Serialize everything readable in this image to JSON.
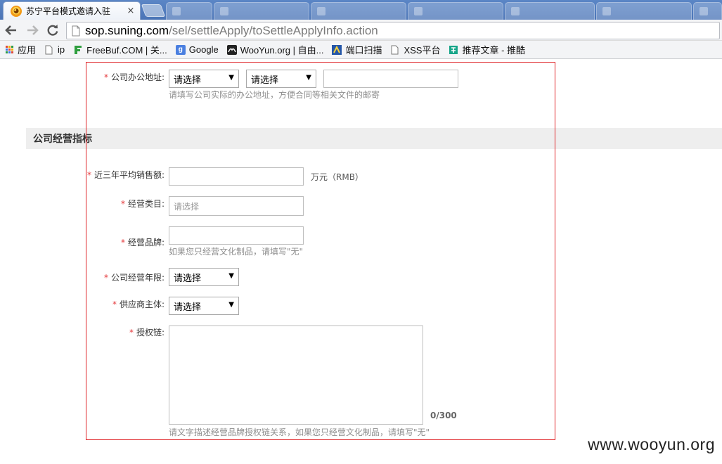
{
  "browser": {
    "active_tab": {
      "title": "苏宁平台模式邀请入驻",
      "close": "×"
    },
    "address": {
      "host": "sop.suning.com",
      "path": "/sel/settleApply/toSettleApplyInfo.action"
    },
    "bookmarks": [
      {
        "label": "应用",
        "icon": "apps-grid-icon"
      },
      {
        "label": "ip",
        "icon": "page-icon"
      },
      {
        "label": "FreeBuf.COM | 关...",
        "icon": "freebuf-icon"
      },
      {
        "label": "Google",
        "icon": "google-icon"
      },
      {
        "label": "WooYun.org | 自由...",
        "icon": "wooyun-icon"
      },
      {
        "label": "端口扫描",
        "icon": "portscan-icon"
      },
      {
        "label": "XSS平台",
        "icon": "page-icon"
      },
      {
        "label": "推荐文章 - 推酷",
        "icon": "tuicool-icon"
      }
    ]
  },
  "form": {
    "office_address": {
      "label": "公司办公地址:",
      "select1": "请选择",
      "select2": "请选择",
      "hint": "请填写公司实际的办公地址，方便合同等相关文件的邮寄"
    },
    "section_title": "公司经营指标",
    "avg_sales": {
      "label": "近三年平均销售额:",
      "unit": "万元（RMB）"
    },
    "category": {
      "label": "经营类目:",
      "placeholder": "请选择"
    },
    "brand": {
      "label": "经营品牌:",
      "hint": "如果您只经营文化制品，请填写\"无\""
    },
    "years": {
      "label": "公司经营年限:",
      "select": "请选择"
    },
    "supplier": {
      "label": "供应商主体:",
      "select": "请选择"
    },
    "auth_chain": {
      "label": "授权链:",
      "counter": "0/300",
      "hint": "请文字描述经营品牌授权链关系，如果您只经营文化制品，请填写\"无\""
    },
    "required_mark": "*"
  },
  "watermark": "www.wooyun.org",
  "colors": {
    "required": "#e4393c",
    "highlight_box": "#e0262a"
  }
}
